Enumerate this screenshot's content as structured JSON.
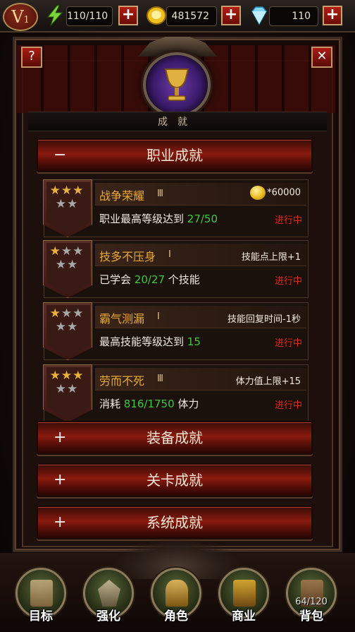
{
  "topbar": {
    "vip_letter": "V",
    "vip_level": "1",
    "energy": "110/110",
    "gold": "481572",
    "diamonds": "110",
    "plus_label": "+"
  },
  "panel": {
    "help_label": "?",
    "close_label": "✕",
    "title": "成就"
  },
  "categories": {
    "career": {
      "sign": "−",
      "label": "职业成就"
    },
    "equipment": {
      "sign": "+",
      "label": "装备成就"
    },
    "stage": {
      "sign": "+",
      "label": "关卡成就"
    },
    "system": {
      "sign": "+",
      "label": "系统成就"
    }
  },
  "achievements": [
    {
      "name": "战争荣耀",
      "level": "Ⅲ",
      "gold_stars": 3,
      "silver_stars": 2,
      "reward": "*60000",
      "reward_icon": "gold-coin-icon",
      "desc_pre": "职业最高等级达到 ",
      "progress": "27/50",
      "desc_post": "",
      "status": "进行中"
    },
    {
      "name": "技多不压身",
      "level": "Ⅰ",
      "gold_stars": 1,
      "silver_stars": 2,
      "reward": "技能点上限+1",
      "desc_pre": "已学会 ",
      "progress": "20/27",
      "desc_post": " 个技能",
      "status": "进行中"
    },
    {
      "name": "霸气测漏",
      "level": "Ⅰ",
      "gold_stars": 1,
      "silver_stars": 2,
      "reward": "技能回复时间-1秒",
      "desc_pre": "最高技能等级达到 ",
      "progress": "15",
      "desc_post": "",
      "status": "进行中"
    },
    {
      "name": "劳而不死",
      "level": "Ⅲ",
      "gold_stars": 3,
      "silver_stars": 2,
      "reward": "体力值上限+15",
      "desc_pre": "消耗 ",
      "progress": "816/1750",
      "desc_post": " 体力",
      "status": "进行中"
    }
  ],
  "nav": {
    "items": [
      "目标",
      "强化",
      "角色",
      "商业",
      "背包"
    ],
    "bag_count": "64/120"
  },
  "colors": {
    "accent_red": "#8a1a0e",
    "gold_text": "#e8a838",
    "progress_green": "#3ec83e",
    "status_red": "#e0281a"
  }
}
